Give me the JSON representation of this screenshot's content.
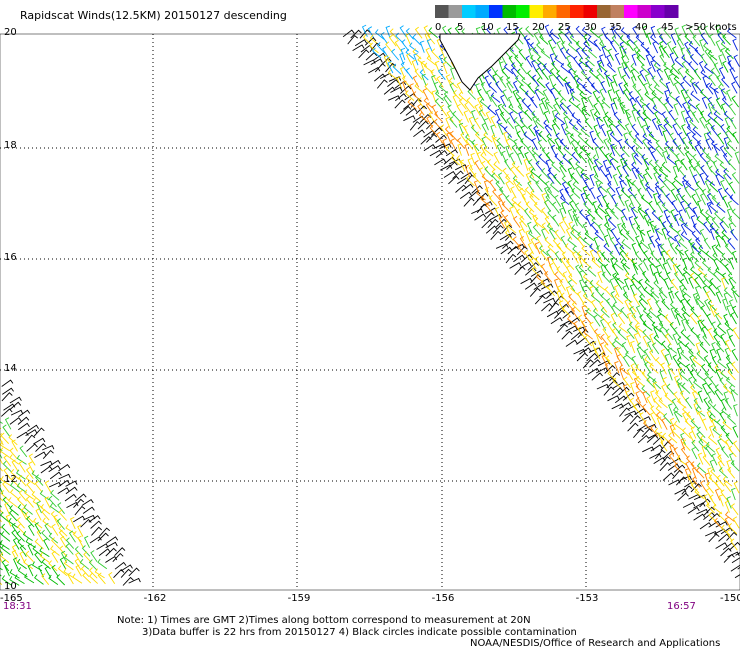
{
  "title": "Rapidscat Winds(12.5KM) 20150127 descending",
  "legend": {
    "colors": [
      "#555555",
      "#9a9a9a",
      "#00ccff",
      "#00aaff",
      "#0033ff",
      "#00bb00",
      "#00ee00",
      "#ffee00",
      "#ffaa00",
      "#ff6600",
      "#ff2200",
      "#ee0000",
      "#996633",
      "#c08060",
      "#ff00ff",
      "#cc00cc",
      "#8800cc",
      "#6600aa"
    ],
    "labels": [
      "0",
      "5",
      "10",
      "15",
      "20",
      "25",
      "30",
      "35",
      "40",
      "45",
      ">50 knots"
    ]
  },
  "axes": {
    "y_labels": [
      "20",
      "18",
      "16",
      "14",
      "12",
      "10"
    ],
    "x_labels": [
      "-162",
      "-159",
      "-156",
      "-153"
    ],
    "x_left_edge": "-165",
    "x_right_edge": "-150"
  },
  "times": {
    "left": "18:31",
    "right": "16:57"
  },
  "notes": {
    "line1": "Note: 1) Times are GMT 2)Times along bottom correspond to measurement at 20N",
    "line2": "3)Data buffer is 22 hrs from 20150127 4) Black circles indicate possible contamination",
    "line3": "NOAA/NESDIS/Office of Research and Applications"
  },
  "wind_colors": {
    "black": "#000000",
    "blue": "#0022dd",
    "lightblue": "#00aaff",
    "green": "#00bb00",
    "lightgreen": "#33cc33",
    "yellow": "#ffdd00",
    "orange": "#ff8800"
  }
}
